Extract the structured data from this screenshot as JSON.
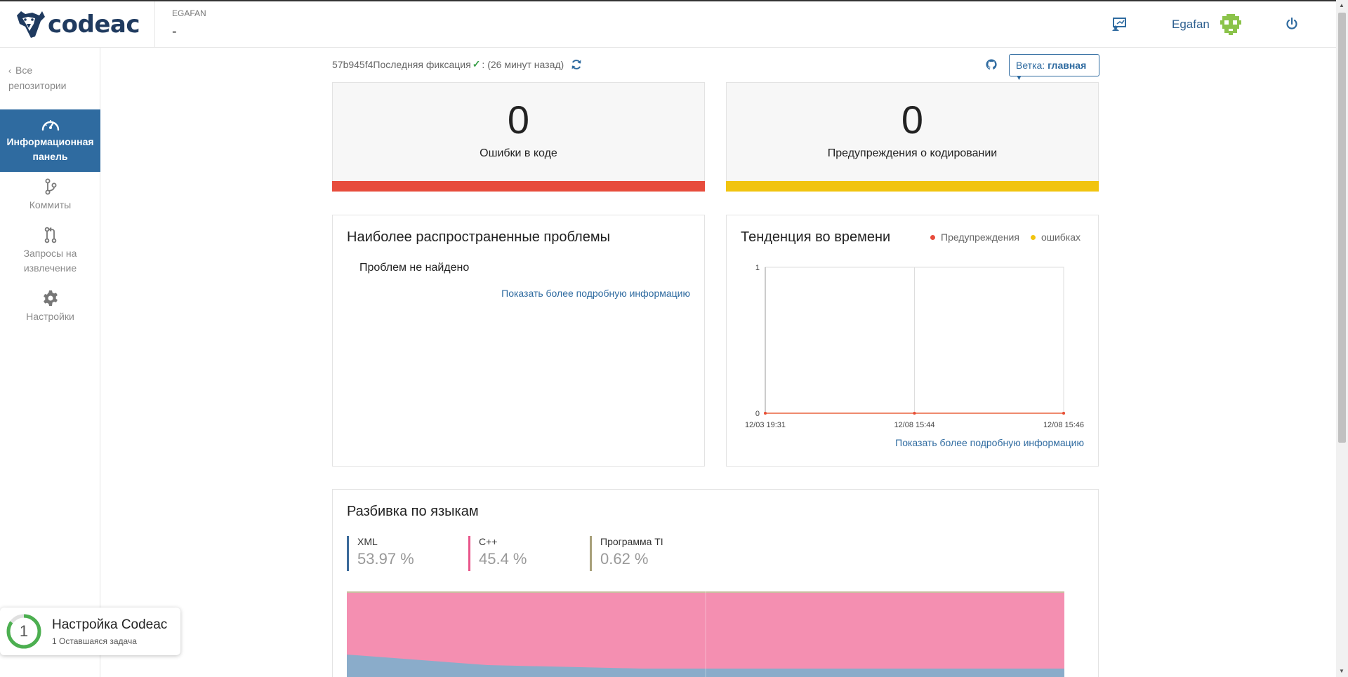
{
  "app": {
    "logo_text": "codeac"
  },
  "header": {
    "org": "EGAFAN",
    "repo": "-",
    "username": "Egafan",
    "icons": [
      "presentation-icon",
      "avatar",
      "power-icon"
    ]
  },
  "sidebar": {
    "back_label": "Все репозитории",
    "items": [
      {
        "label": "Информационная панель",
        "icon": "dashboard-gauge-icon",
        "active": true
      },
      {
        "label": "Коммиты",
        "icon": "git-branch-icon",
        "active": false
      },
      {
        "label": "Запросы на извлечение",
        "icon": "pull-request-icon",
        "active": false
      },
      {
        "label": "Настройки",
        "icon": "gear-icon",
        "active": false
      }
    ]
  },
  "commit": {
    "hash": "57b945f4",
    "label": "Последняя фиксация",
    "check": "✓",
    "time": ": (26 минут назад)"
  },
  "branch": {
    "prefix": "Ветка:",
    "name": "главная"
  },
  "stats": [
    {
      "value": "0",
      "label": "Ошибки в коде",
      "color": "#e74c3c"
    },
    {
      "value": "0",
      "label": "Предупреждения о кодировании",
      "color": "#f1c40f"
    }
  ],
  "problems": {
    "title": "Наиболее распространенные проблемы",
    "empty": "Проблем не найдено",
    "more_link": "Показать более подробную информацию"
  },
  "trend": {
    "title": "Тенденция во времени",
    "legend": [
      {
        "name": "Предупреждения",
        "color": "#e74c3c"
      },
      {
        "name": "ошибках",
        "color": "#f1c40f"
      }
    ],
    "more_link": "Показать более подробную информацию"
  },
  "chart_data": {
    "type": "line",
    "categories": [
      "12/03 19:31",
      "12/08 15:44",
      "12/08 15:46"
    ],
    "series": [
      {
        "name": "Предупреждения",
        "values": [
          0,
          0,
          0
        ],
        "color": "#e74c3c"
      },
      {
        "name": "ошибках",
        "values": [
          0,
          0,
          0
        ],
        "color": "#f1c40f"
      }
    ],
    "yticks": [
      "1",
      "0"
    ],
    "ylim": [
      0,
      1
    ],
    "grid": true,
    "legend_position": "top-right"
  },
  "languages": {
    "title": "Разбивка по языкам",
    "items": [
      {
        "name": "XML",
        "percent": "53.97 %",
        "color": "#3b6a9a"
      },
      {
        "name": "C++",
        "percent": "45.4 %",
        "color": "#e8558a"
      },
      {
        "name": "Программа TI",
        "percent": "0.62 %",
        "color": "#a8a07a"
      }
    ],
    "area_colors": {
      "top": "#f48fb1",
      "bottom": "#8aacca"
    }
  },
  "toast": {
    "count": "1",
    "title": "Настройка Codeac",
    "subtitle": "1 Оставшаяся задача",
    "progress": 0.85,
    "color": "#4caf50"
  }
}
